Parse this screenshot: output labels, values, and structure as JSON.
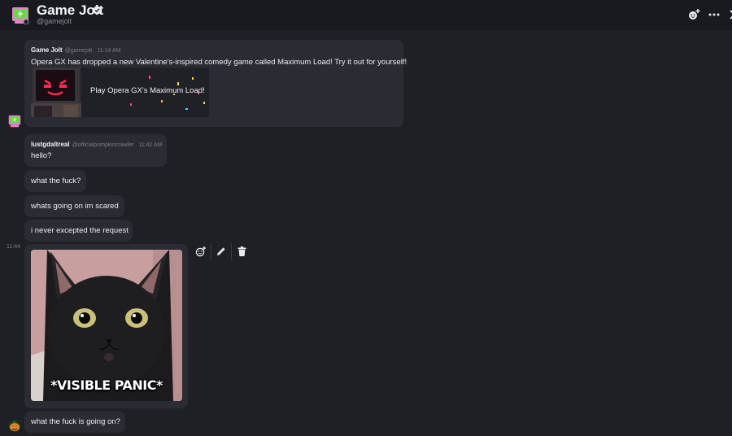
{
  "header": {
    "title": "Game Jolt",
    "handle": "@gamejolt",
    "icons": [
      "game-jolt-avatar",
      "verified-badge-icon",
      "add-member-icon",
      "more-options-icon",
      "close-icon"
    ]
  },
  "messages": [
    {
      "author": "Game Jolt",
      "handle": "@gamejolt",
      "time": "11:14 AM",
      "text": "Opera GX has dropped a new Valentine's-inspired comedy game called Maximum Load! Try it out for yourself!",
      "embed_label": "Play Opera GX's Maximum Load!"
    },
    {
      "author": "lustgdaltreal",
      "handle": "@officialpumpkincrawler",
      "time": "11:42 AM",
      "lines": [
        "hello?",
        "what the fuck?",
        "whats going on im scared",
        "i never excepted the request"
      ]
    },
    {
      "side_time": "11:44",
      "image_caption": "*VISIBLE PANIC*"
    },
    {
      "text": "what the fuck is going on?"
    }
  ],
  "toolbar": {
    "icons": [
      "add-reaction-icon",
      "edit-icon",
      "delete-icon"
    ]
  },
  "colors": {
    "background": "#1f1f26",
    "bubble": "#2b2b33",
    "header": "#191920",
    "accent_green": "#6dd64e",
    "accent_pink": "#e680c8"
  }
}
